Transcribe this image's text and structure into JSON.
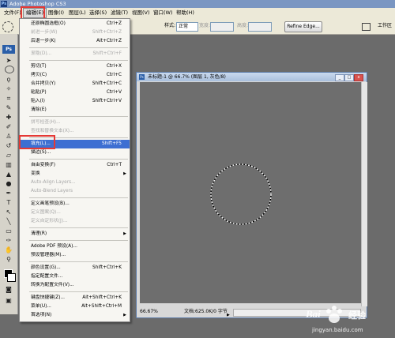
{
  "app": {
    "title": "Adobe Photoshop CS3"
  },
  "menubar": {
    "items": [
      "文件(F)",
      "编辑(E)",
      "图像(I)",
      "图层(L)",
      "选择(S)",
      "滤镜(T)",
      "视图(V)",
      "窗口(W)",
      "帮助(H)"
    ]
  },
  "options": {
    "style_label": "样式:",
    "style_value": "正常",
    "width_label": "宽度:",
    "height_label": "高度:",
    "refine_edge": "Refine Edge...",
    "workspace": "工作区"
  },
  "document": {
    "title": "未标题-1 @ 66.7% (图层 1, 灰色/8)",
    "zoom": "66.67%",
    "info": "文档:625.0K/0 字节"
  },
  "edit_menu": {
    "items": [
      {
        "label": "还原椭圆选框(O)",
        "shortcut": "Ctrl+Z",
        "disabled": false
      },
      {
        "label": "前进一步(W)",
        "shortcut": "Shift+Ctrl+Z",
        "disabled": true
      },
      {
        "label": "后退一步(K)",
        "shortcut": "Alt+Ctrl+Z",
        "disabled": false
      },
      {
        "sep": true
      },
      {
        "label": "渐隐(D)...",
        "shortcut": "Shift+Ctrl+F",
        "disabled": true
      },
      {
        "sep": true
      },
      {
        "label": "剪切(T)",
        "shortcut": "Ctrl+X",
        "disabled": false
      },
      {
        "label": "拷贝(C)",
        "shortcut": "Ctrl+C",
        "disabled": false
      },
      {
        "label": "合并拷贝(Y)",
        "shortcut": "Shift+Ctrl+C",
        "disabled": false
      },
      {
        "label": "粘贴(P)",
        "shortcut": "Ctrl+V",
        "disabled": false
      },
      {
        "label": "贴入(I)",
        "shortcut": "Shift+Ctrl+V",
        "disabled": false
      },
      {
        "label": "清除(E)",
        "shortcut": "",
        "disabled": false
      },
      {
        "sep": true
      },
      {
        "label": "拼写检查(H)...",
        "shortcut": "",
        "disabled": true
      },
      {
        "label": "查找和替换文本(X)...",
        "shortcut": "",
        "disabled": true
      },
      {
        "sep": true
      },
      {
        "label": "填充(L)...",
        "shortcut": "Shift+F5",
        "disabled": false,
        "highlighted": true
      },
      {
        "label": "描边(S)...",
        "shortcut": "",
        "disabled": false
      },
      {
        "sep": true
      },
      {
        "label": "自由变换(F)",
        "shortcut": "Ctrl+T",
        "disabled": false
      },
      {
        "label": "变换",
        "shortcut": "",
        "disabled": false,
        "arrow": true
      },
      {
        "label": "Auto-Align Layers...",
        "shortcut": "",
        "disabled": true
      },
      {
        "label": "Auto-Blend Layers",
        "shortcut": "",
        "disabled": true
      },
      {
        "sep": true
      },
      {
        "label": "定义画笔预设(B)...",
        "shortcut": "",
        "disabled": false
      },
      {
        "label": "定义图案(Q)...",
        "shortcut": "",
        "disabled": true
      },
      {
        "label": "定义自定形状(J)...",
        "shortcut": "",
        "disabled": true
      },
      {
        "sep": true
      },
      {
        "label": "清理(R)",
        "shortcut": "",
        "disabled": false,
        "arrow": true
      },
      {
        "sep": true
      },
      {
        "label": "Adobe PDF 预设(A)...",
        "shortcut": "",
        "disabled": false
      },
      {
        "label": "预设管理器(M)...",
        "shortcut": "",
        "disabled": false
      },
      {
        "sep": true
      },
      {
        "label": "颜色设置(G)...",
        "shortcut": "Shift+Ctrl+K",
        "disabled": false
      },
      {
        "label": "指定配置文件...",
        "shortcut": "",
        "disabled": false
      },
      {
        "label": "转换为配置文件(V)...",
        "shortcut": "",
        "disabled": false
      },
      {
        "sep": true
      },
      {
        "label": "键盘快捷键(Z)...",
        "shortcut": "Alt+Shift+Ctrl+K",
        "disabled": false
      },
      {
        "label": "菜单(U)...",
        "shortcut": "Alt+Shift+Ctrl+M",
        "disabled": false
      },
      {
        "label": "首选项(N)",
        "shortcut": "",
        "disabled": false,
        "arrow": true
      }
    ]
  },
  "watermark": {
    "brand": "Bai",
    "brand2": "经验",
    "url": "jingyan.baidu.com"
  },
  "colors": {
    "highlight": "#3d6fd2",
    "annotation_red": "#e53935",
    "canvas": "#6e6e6e"
  }
}
